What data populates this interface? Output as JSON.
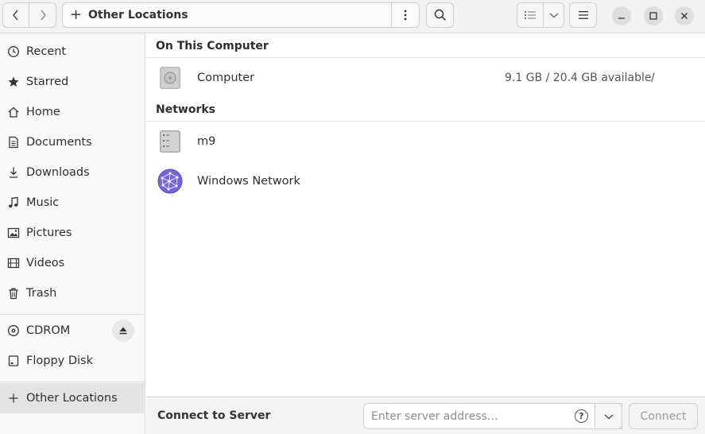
{
  "header": {
    "location_label": "Other Locations"
  },
  "sidebar": {
    "items": [
      {
        "label": "Recent",
        "icon": "clock-icon"
      },
      {
        "label": "Starred",
        "icon": "star-icon"
      },
      {
        "label": "Home",
        "icon": "home-icon"
      },
      {
        "label": "Documents",
        "icon": "document-icon"
      },
      {
        "label": "Downloads",
        "icon": "download-icon"
      },
      {
        "label": "Music",
        "icon": "music-note-icon"
      },
      {
        "label": "Pictures",
        "icon": "picture-icon"
      },
      {
        "label": "Videos",
        "icon": "film-icon"
      },
      {
        "label": "Trash",
        "icon": "trash-icon"
      }
    ],
    "devices": [
      {
        "label": "CDROM",
        "icon": "disc-icon"
      },
      {
        "label": "Floppy Disk",
        "icon": "drive-icon"
      }
    ],
    "other": {
      "label": "Other Locations",
      "icon": "plus-icon"
    }
  },
  "main": {
    "on_this_computer": {
      "title": "On This Computer",
      "items": [
        {
          "name": "Computer",
          "info": "9.1 GB / 20.4 GB available",
          "path": "/"
        }
      ]
    },
    "networks": {
      "title": "Networks",
      "items": [
        {
          "name": "m9"
        },
        {
          "name": "Windows Network"
        }
      ]
    }
  },
  "bottom": {
    "label": "Connect to Server",
    "placeholder": "Enter server address…",
    "help": "?",
    "connect_label": "Connect"
  },
  "colors": {
    "accent_network": "#7764d8",
    "sidebar_active": "#e3e3e3"
  }
}
